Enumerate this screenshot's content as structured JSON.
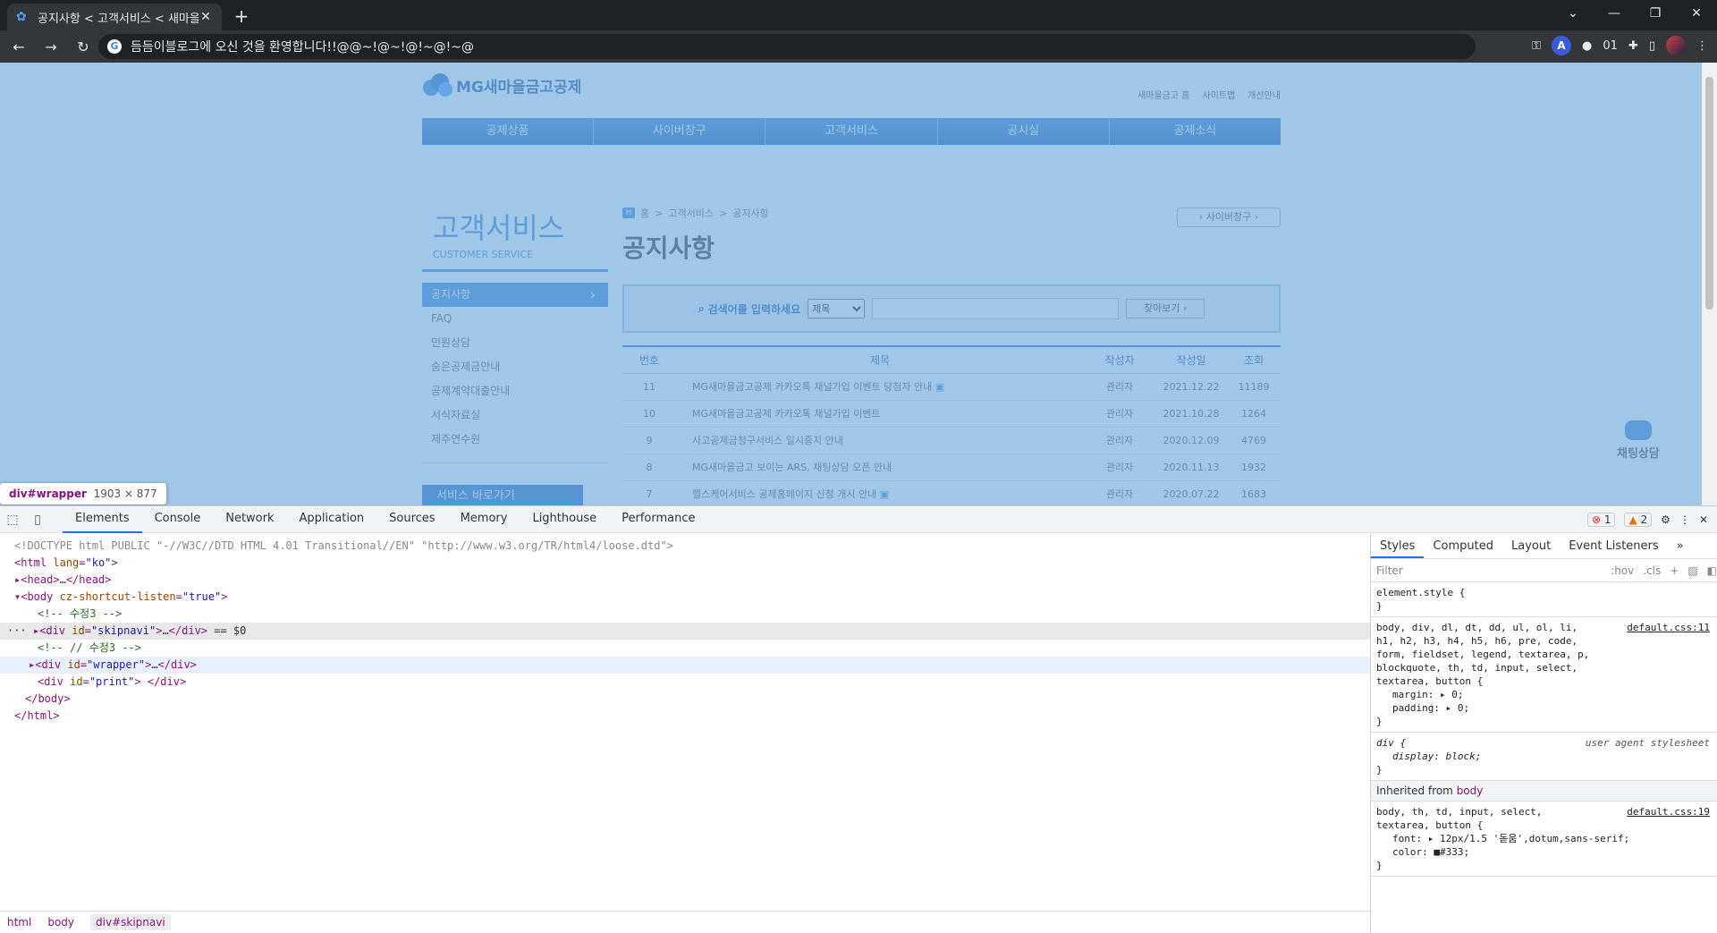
{
  "browser": {
    "tab_title": "공지사항 < 고객서비스 < 새마을",
    "url": "듬듬이블로그에 오신 것을 환영합니다!!@@~!@~!@!~@!~@",
    "ext_count": "01",
    "profile_letter": "A"
  },
  "site": {
    "logo": "MG새마을금고공제",
    "util": [
      "새마을금고 홈",
      "사이트맵",
      "개선안내"
    ],
    "gnb": [
      "공제상품",
      "사이버창구",
      "고객서비스",
      "공시실",
      "공제소식"
    ],
    "lnb_title": "고객서비스",
    "lnb_sub": "CUSTOMER SERVICE",
    "lnb_items": [
      "공지사항",
      "FAQ",
      "민원상담",
      "숨은공제금안내",
      "공제계약대출안내",
      "서식자료실",
      "제주연수원"
    ],
    "quick": "서비스 바로가기",
    "breadcrumb": [
      "홈",
      "고객서비스",
      "공지사항"
    ],
    "cyber_btn": "사이버창구",
    "page_title": "공지사항",
    "search_label": "검색어를 입력하세요",
    "search_select": "제목",
    "search_btn": "찾아보기",
    "table": {
      "headers": [
        "번호",
        "제목",
        "작성자",
        "작성일",
        "조회"
      ],
      "rows": [
        [
          "11",
          "MG새마을금고공제 카카오톡 채널가입 이벤트 당첨자 안내",
          "관리자",
          "2021.12.22",
          "11189"
        ],
        [
          "10",
          "MG새마을금고공제 카카오톡 채널가입 이벤트",
          "관리자",
          "2021.10.28",
          "1264"
        ],
        [
          "9",
          "사고공제금청구서비스 일시중지 안내",
          "관리자",
          "2020.12.09",
          "4769"
        ],
        [
          "8",
          "MG새마을금고 보이는 ARS, 채팅상담 오픈 안내",
          "관리자",
          "2020.11.13",
          "1932"
        ],
        [
          "7",
          "헬스케어서비스 공제홈페이지 신청 개시 안내",
          "관리자",
          "2020.07.22",
          "1683"
        ]
      ]
    },
    "chat": "채팅상담"
  },
  "tooltip": {
    "el": "div#wrapper",
    "size": "1903 × 877"
  },
  "devtools": {
    "tabs": [
      "Elements",
      "Console",
      "Network",
      "Application",
      "Sources",
      "Memory",
      "Lighthouse",
      "Performance"
    ],
    "errors": "1",
    "warnings": "2",
    "doctype": "<!DOCTYPE html PUBLIC \"-//W3C//DTD HTML 4.01 Transitional//EN\" \"http://www.w3.org/TR/html4/loose.dtd\">",
    "comment1": "<!-- 수정3 -->",
    "comment2": "<!-- // 수정3 -->",
    "eq": "== $0",
    "crumbs": [
      "html",
      "body",
      "div#skipnavi"
    ],
    "style_tabs": [
      "Styles",
      "Computed",
      "Layout",
      "Event Listeners"
    ],
    "filter": "Filter",
    "hov": ":hov",
    "cls": ".cls",
    "rule1_src": "default.css:11",
    "rule1_sel": "body, div, dl, dt, dd, ul, ol, li, h1, h2, h3, h4, h5, h6, pre, code, form, fieldset, legend, textarea, p, blockquote, th, td, input, select, textarea, button {",
    "rule1_p1": "margin: ▸ 0;",
    "rule1_p2": "padding: ▸ 0;",
    "rule2_sel": "div {",
    "rule2_src": "user agent stylesheet",
    "rule2_p": "display: block;",
    "inherited": "Inherited from",
    "inherited_el": "body",
    "rule3_sel": "body, th, td, input, select, textarea, button {",
    "rule3_src": "default.css:19",
    "rule3_p1": "font: ▸ 12px/1.5 '돋움',dotum,sans-serif;",
    "rule3_p2": "color: ■#333;"
  }
}
